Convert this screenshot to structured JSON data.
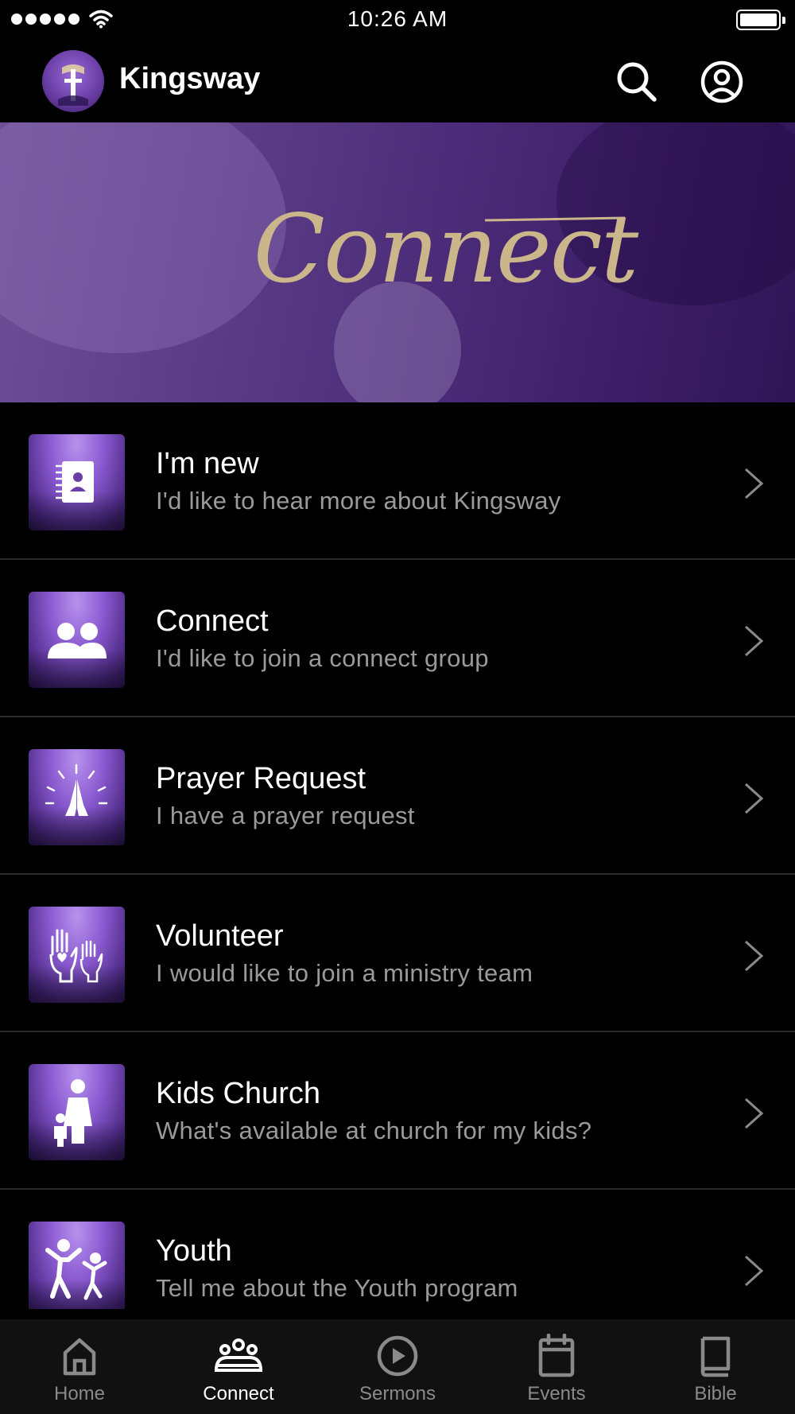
{
  "status_bar": {
    "time": "10:26 AM"
  },
  "header": {
    "title": "Kingsway",
    "search_icon": "search-icon",
    "profile_icon": "user-circle-icon"
  },
  "hero": {
    "title": "Connect"
  },
  "items": [
    {
      "title": "I'm new",
      "subtitle": "I'd like to hear more about Kingsway",
      "icon": "contact-book-icon"
    },
    {
      "title": "Connect",
      "subtitle": "I'd like to join a connect group",
      "icon": "people-icon"
    },
    {
      "title": "Prayer Request",
      "subtitle": "I have a prayer request",
      "icon": "praying-hands-icon"
    },
    {
      "title": "Volunteer",
      "subtitle": "I would like to join a ministry team",
      "icon": "raised-hands-icon"
    },
    {
      "title": "Kids Church",
      "subtitle": "What's available at church for my kids?",
      "icon": "parent-child-icon"
    },
    {
      "title": "Youth",
      "subtitle": "Tell me about the Youth program",
      "icon": "jumping-kids-icon"
    }
  ],
  "tabs": [
    {
      "label": "Home",
      "icon": "home-icon",
      "active": false
    },
    {
      "label": "Connect",
      "icon": "group-icon",
      "active": true
    },
    {
      "label": "Sermons",
      "icon": "play-circle-icon",
      "active": false
    },
    {
      "label": "Events",
      "icon": "calendar-icon",
      "active": false
    },
    {
      "label": "Bible",
      "icon": "book-icon",
      "active": false
    }
  ],
  "colors": {
    "accent_purple": "#6a3fa6",
    "hero_script": "#cbb58a",
    "subtitle_gray": "#9a9a9a",
    "tab_inactive": "#8a8a8a"
  }
}
